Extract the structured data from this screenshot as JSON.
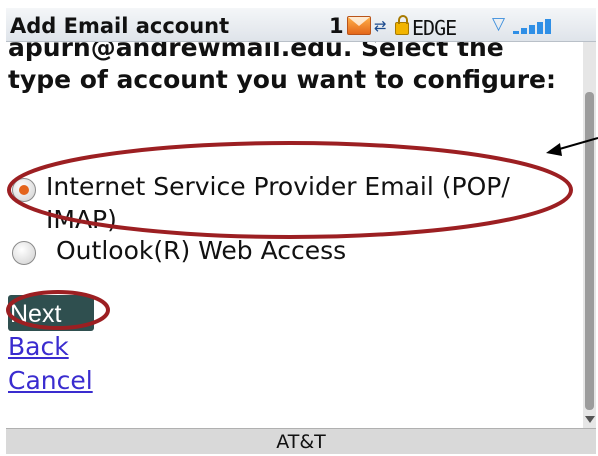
{
  "status_bar": {
    "title": "Add Email account",
    "unread_count": "1",
    "network_label": "EDGE",
    "icons": [
      "mail-icon",
      "network-icon",
      "lock-icon",
      "wifi-icon",
      "signal-icon"
    ]
  },
  "form": {
    "prompt_partial": "apurn@andrewmail.edu. Select the",
    "prompt": "type of account you want to configure:",
    "options": [
      {
        "label": "Internet Service Provider Email (POP/ IMAP)",
        "checked": true
      },
      {
        "label": "Outlook(R) Web Access",
        "checked": false
      }
    ],
    "next_label": "Next",
    "back_label": "Back",
    "cancel_label": "Cancel"
  },
  "footer": {
    "carrier": "AT&T"
  },
  "colors": {
    "highlight_ellipse": "#9c1f22",
    "radio_selected": "#e4641c",
    "link": "#3a2ccf",
    "next_button_bg": "#2f4f4f"
  }
}
